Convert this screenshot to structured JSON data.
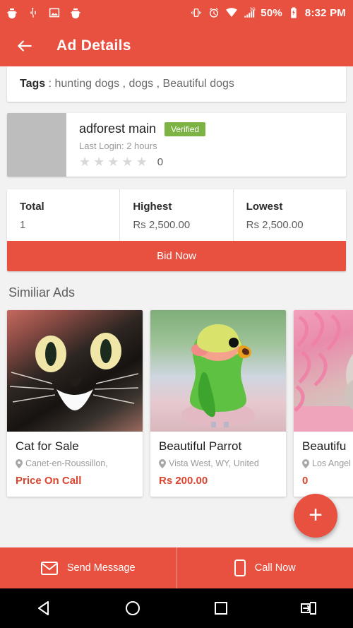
{
  "status_bar": {
    "left_icons": [
      "bug-icon",
      "usb-icon",
      "screenshot-icon",
      "bug-icon"
    ],
    "right_icons": [
      "vibrate-icon",
      "alarm-icon",
      "wifi-icon",
      "signal-3g-icon",
      "battery-icon"
    ],
    "battery_percent": "50%",
    "time": "8:32 PM"
  },
  "app_bar": {
    "back_icon": "arrow-back-icon",
    "title": "Ad Details"
  },
  "tags": {
    "label": "Tags",
    "separator": " : ",
    "value": "hunting dogs , dogs , Beautiful dogs"
  },
  "seller": {
    "name": "adforest main",
    "verified_badge": "Verified",
    "last_login": "Last Login: 2 hours",
    "rating_stars": 5,
    "rating_count": "0"
  },
  "bids": {
    "columns": [
      {
        "label": "Total",
        "value": "1"
      },
      {
        "label": "Highest",
        "value": "Rs 2,500.00"
      },
      {
        "label": "Lowest",
        "value": "Rs 2,500.00"
      }
    ],
    "bid_now_label": "Bid Now"
  },
  "similar": {
    "heading": "Similiar Ads",
    "ads": [
      {
        "title": "Cat for Sale",
        "location": "Canet-en-Roussillon,",
        "price": "Price On Call",
        "image": "cat-photo"
      },
      {
        "title": "Beautiful Parrot",
        "location": "Vista West, WY, United",
        "price": "Rs 200.00",
        "image": "parrot-photo"
      },
      {
        "title": "Beautifu",
        "location": "Los Angel",
        "price": "0",
        "image": "pink-pet-photo"
      }
    ]
  },
  "fab": {
    "icon": "plus-icon"
  },
  "action_bar": {
    "buttons": [
      {
        "label": "Send Message",
        "icon": "envelope-icon"
      },
      {
        "label": "Call Now",
        "icon": "phone-icon"
      }
    ]
  },
  "nav_bar": {
    "buttons": [
      "back-triangle-icon",
      "home-circle-icon",
      "recents-square-icon",
      "screen-rotate-icon"
    ]
  },
  "colors": {
    "accent": "#e8503f",
    "verified_green": "#7cb342",
    "price_red": "#d9452f",
    "page_background": "#f2f2f2"
  }
}
